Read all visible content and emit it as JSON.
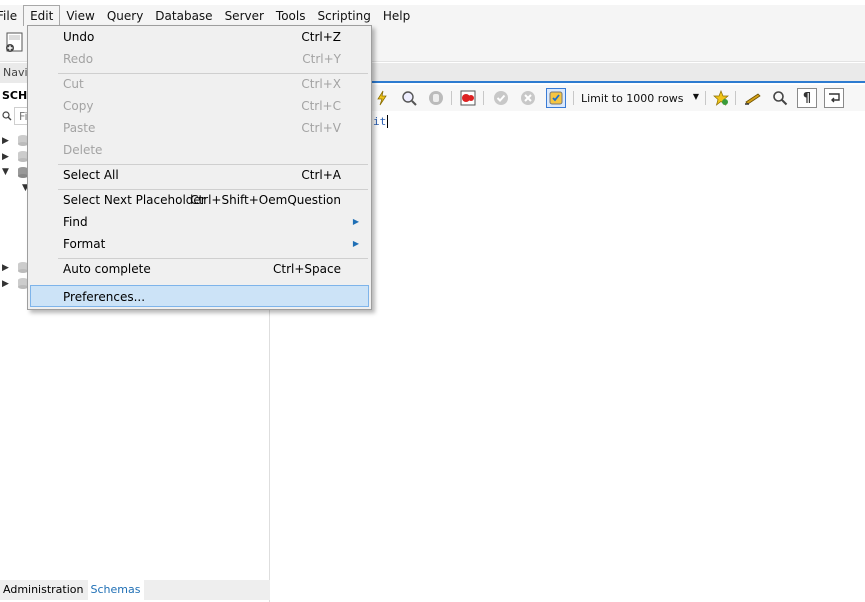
{
  "menubar": {
    "items": [
      "File",
      "Edit",
      "View",
      "Query",
      "Database",
      "Server",
      "Tools",
      "Scripting",
      "Help"
    ]
  },
  "navigator": {
    "header": "Navi",
    "schemas_label": "SCHE",
    "filter_placeholder": "Fi"
  },
  "bottom_tabs": [
    "Administration",
    "Schemas"
  ],
  "editor": {
    "limit_label": "Limit to 1000 rows",
    "code_fragment": "it"
  },
  "edit_menu": {
    "items": [
      {
        "label": "Undo",
        "shortcut": "Ctrl+Z"
      },
      {
        "label": "Redo",
        "shortcut": "Ctrl+Y"
      },
      {
        "label": "Cut",
        "shortcut": "Ctrl+X"
      },
      {
        "label": "Copy",
        "shortcut": "Ctrl+C"
      },
      {
        "label": "Paste",
        "shortcut": "Ctrl+V"
      },
      {
        "label": "Delete",
        "shortcut": ""
      },
      {
        "label": "Select All",
        "shortcut": "Ctrl+A"
      },
      {
        "label": "Select Next Placeholder",
        "shortcut": "Ctrl+Shift+OemQuestion"
      },
      {
        "label": "Find",
        "shortcut": ""
      },
      {
        "label": "Format",
        "shortcut": ""
      },
      {
        "label": "Auto complete",
        "shortcut": "Ctrl+Space"
      },
      {
        "label": "Preferences...",
        "shortcut": ""
      }
    ],
    "highlighted": "Preferences..."
  },
  "colors": {
    "accent": "#2d7bd0",
    "highlight_bg": "#cce3f7",
    "disabled_text": "#a3a3a3"
  }
}
